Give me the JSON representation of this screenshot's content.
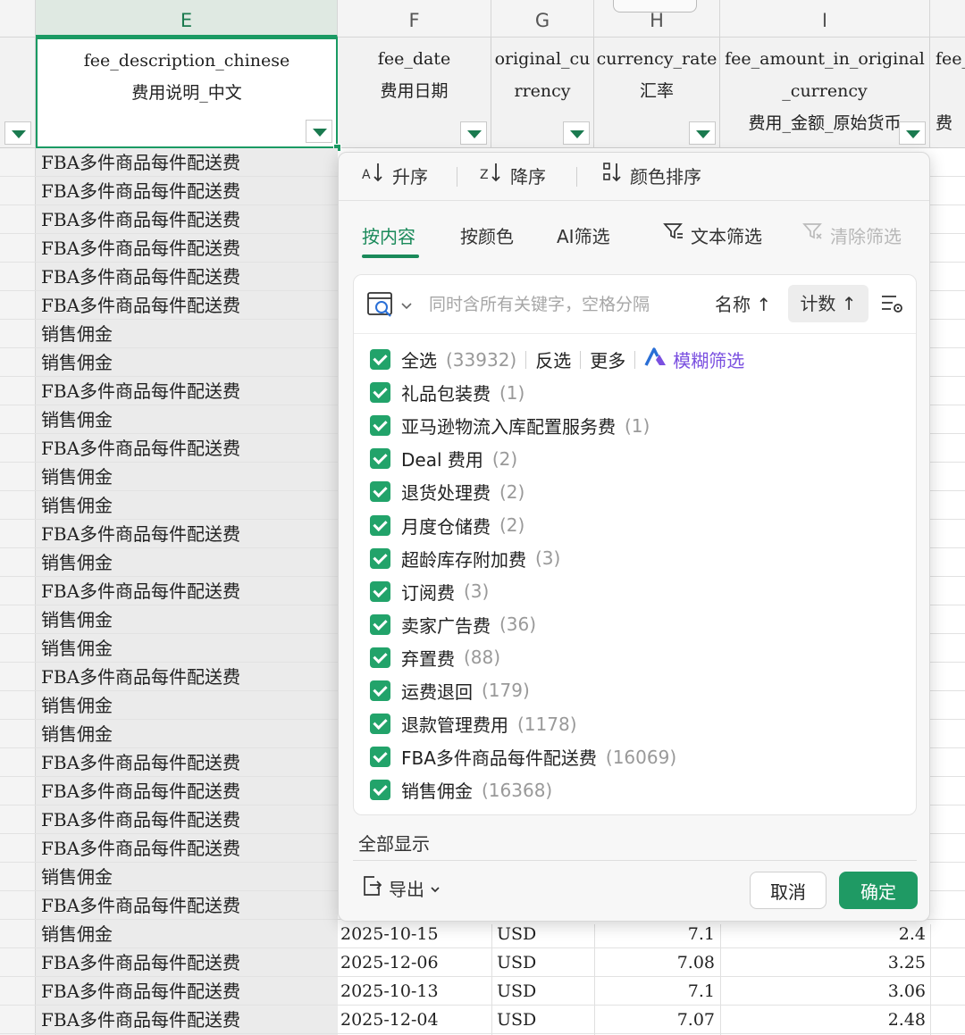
{
  "columns": {
    "letters": [
      "E",
      "F",
      "G",
      "H",
      "I"
    ],
    "headers": [
      {
        "en": "fee_description_chinese",
        "cn": "费用说明_中文"
      },
      {
        "en": "fee_date",
        "cn": "费用日期"
      },
      {
        "en": "original_cu",
        "en2": "rrency",
        "cn": ""
      },
      {
        "en": "currency_rate",
        "cn": "汇率"
      },
      {
        "en": "fee_amount_in_original",
        "en2": "_currency",
        "cn": "费用_金额_原始货币"
      },
      {
        "en": "fee_",
        "cn": "费"
      }
    ]
  },
  "rows_col_e": [
    "FBA多件商品每件配送费",
    "FBA多件商品每件配送费",
    "FBA多件商品每件配送费",
    "FBA多件商品每件配送费",
    "FBA多件商品每件配送费",
    "FBA多件商品每件配送费",
    "销售佣金",
    "销售佣金",
    "FBA多件商品每件配送费",
    "销售佣金",
    "FBA多件商品每件配送费",
    "销售佣金",
    "销售佣金",
    "FBA多件商品每件配送费",
    "销售佣金",
    "FBA多件商品每件配送费",
    "销售佣金",
    "销售佣金",
    "FBA多件商品每件配送费",
    "销售佣金",
    "销售佣金",
    "FBA多件商品每件配送费",
    "FBA多件商品每件配送费",
    "FBA多件商品每件配送费",
    "FBA多件商品每件配送费",
    "销售佣金",
    "FBA多件商品每件配送费",
    "销售佣金",
    "FBA多件商品每件配送费",
    "FBA多件商品每件配送费",
    "FBA多件商品每件配送费"
  ],
  "visible_rows": [
    {
      "date": "2025-10-15",
      "currency": "USD",
      "rate": "7.1",
      "amount": "2.4"
    },
    {
      "date": "2025-12-06",
      "currency": "USD",
      "rate": "7.08",
      "amount": "3.25"
    },
    {
      "date": "2025-10-13",
      "currency": "USD",
      "rate": "7.1",
      "amount": "3.06"
    },
    {
      "date": "2025-12-04",
      "currency": "USD",
      "rate": "7.07",
      "amount": "2.48"
    }
  ],
  "popup": {
    "sort": {
      "asc": "升序",
      "desc": "降序",
      "color": "颜色排序"
    },
    "tabs": {
      "content": "按内容",
      "color": "按颜色",
      "ai": "AI筛选",
      "text": "文本筛选",
      "clear": "清除筛选"
    },
    "search": {
      "placeholder": "同时含所有关键字，空格分隔",
      "sort_name": "名称 ↑",
      "sort_count": "计数 ↑"
    },
    "select_all": {
      "label": "全选",
      "count": "(33932)",
      "invert": "反选",
      "more": "更多",
      "fuzzy": "模糊筛选"
    },
    "items": [
      {
        "label": "礼品包装费",
        "count": "(1)"
      },
      {
        "label": "亚马逊物流入库配置服务费",
        "count": "(1)"
      },
      {
        "label": "Deal 费用",
        "count": "(2)"
      },
      {
        "label": "退货处理费",
        "count": "(2)"
      },
      {
        "label": "月度仓储费",
        "count": "(2)"
      },
      {
        "label": "超龄库存附加费",
        "count": "(3)"
      },
      {
        "label": "订阅费",
        "count": "(3)"
      },
      {
        "label": "卖家广告费",
        "count": "(36)"
      },
      {
        "label": "弃置费",
        "count": "(88)"
      },
      {
        "label": "运费退回",
        "count": "(179)"
      },
      {
        "label": "退款管理费用",
        "count": "(1178)"
      },
      {
        "label": "FBA多件商品每件配送费",
        "count": "(16069)"
      },
      {
        "label": "销售佣金",
        "count": "(16368)"
      }
    ],
    "show_all": "全部显示",
    "export": "导出",
    "cancel": "取消",
    "ok": "确定"
  },
  "colors": {
    "accent": "#1f9a64",
    "fuzzy": "#7a4fe0"
  }
}
